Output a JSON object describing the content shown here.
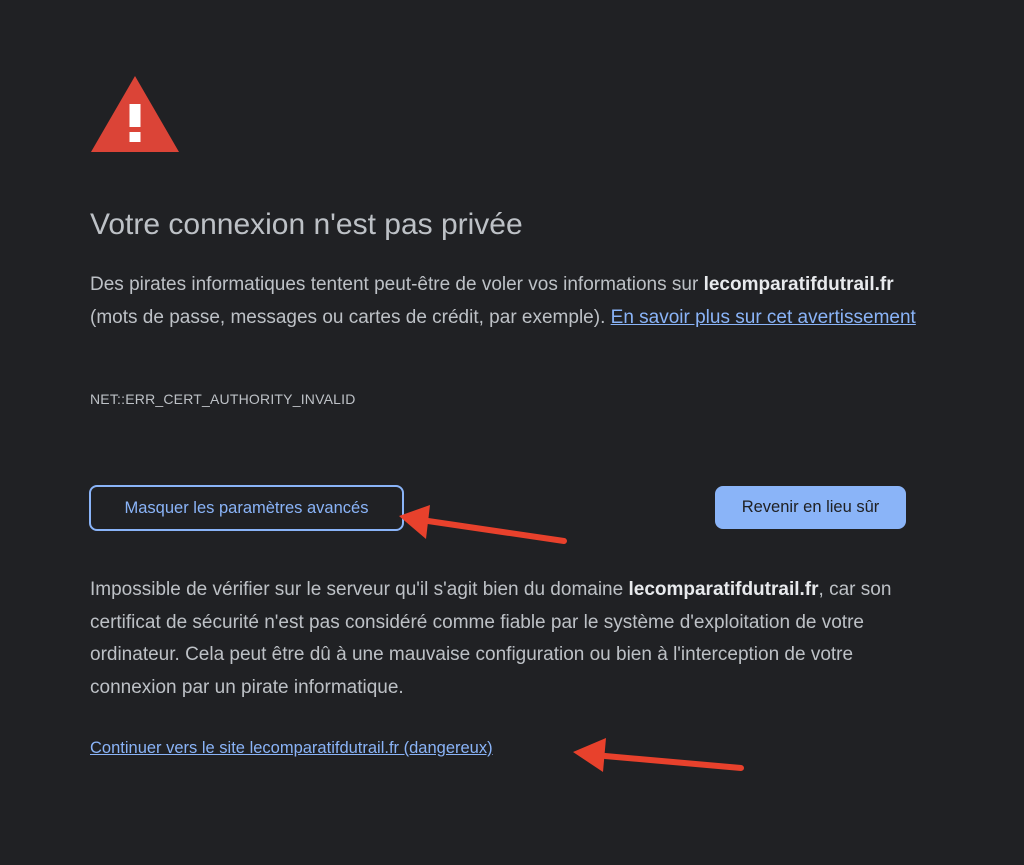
{
  "page": {
    "title": "Votre connexion n'est pas privée",
    "intro_before": "Des pirates informatiques tentent peut-être de voler vos informations sur ",
    "domain": "lecomparatifdutrail.fr",
    "intro_after": " (mots de passe, messages ou cartes de crédit, par exemple). ",
    "learn_more_link": "En savoir plus sur cet avertissement",
    "error_code": "NET::ERR_CERT_AUTHORITY_INVALID",
    "details_before": "Impossible de vérifier sur le serveur qu'il s'agit bien du domaine ",
    "details_after": ", car son certificat de sécurité n'est pas considéré comme fiable par le système d'exploitation de votre ordinateur. Cela peut être dû à une mauvaise configuration ou bien à l'interception de votre connexion par un pirate informatique.",
    "proceed_link": "Continuer vers le site lecomparatifdutrail.fr (dangereux)"
  },
  "buttons": {
    "advanced_label": "Masquer les paramètres avancés",
    "back_label": "Revenir en lieu sûr"
  },
  "icons": {
    "warning": "warning-triangle-icon",
    "annotation": "red-arrow"
  },
  "colors": {
    "background": "#202124",
    "text": "#bdc1c6",
    "emphasis": "#e8eaed",
    "link": "#8ab4f8",
    "warning": "#db4437",
    "annotation_arrow": "#e8412c"
  }
}
